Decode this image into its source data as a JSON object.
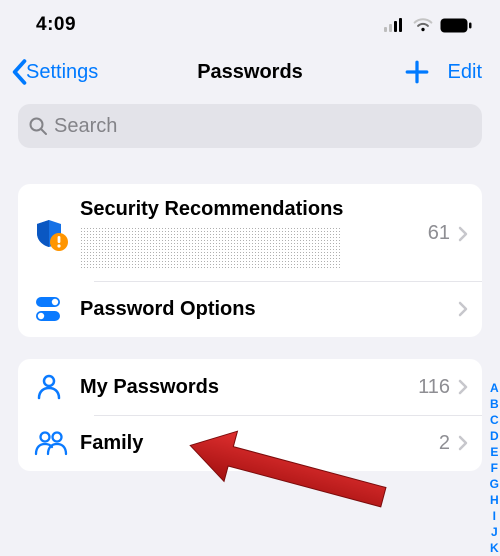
{
  "status": {
    "time": "4:09"
  },
  "nav": {
    "back_label": "Settings",
    "title": "Passwords",
    "edit_label": "Edit"
  },
  "search": {
    "placeholder": "Search"
  },
  "section1": {
    "security": {
      "title": "Security Recommendations",
      "count": "61"
    },
    "options": {
      "title": "Password Options"
    }
  },
  "section2": {
    "mine": {
      "title": "My Passwords",
      "count": "116"
    },
    "family": {
      "title": "Family",
      "count": "2"
    }
  },
  "index_letters": [
    "A",
    "B",
    "C",
    "D",
    "E",
    "F",
    "G",
    "H",
    "I",
    "J",
    "K"
  ]
}
